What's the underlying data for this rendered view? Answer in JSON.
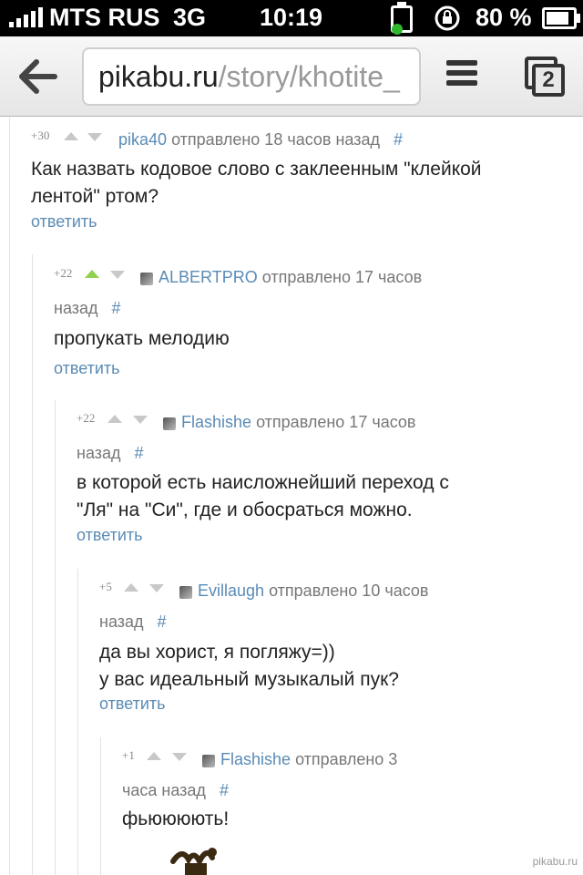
{
  "status": {
    "carrier": "MTS RUS",
    "network": "3G",
    "time": "10:19",
    "battery": "80 %"
  },
  "browser": {
    "url_host": "pikabu.ru",
    "url_path": "/story/khotite_"
  },
  "tabs_count": "2",
  "comments": [
    {
      "score": "+30",
      "nick": "pika40",
      "meta_line1": "отправлено 18 часов назад",
      "meta_line2": "",
      "text_lines": [
        "Как назвать кодовое слово с заклеенным \"клейкой",
        "лентой\" ртом?"
      ],
      "reply": "ответить",
      "upvoted": false,
      "has_avatar": false
    },
    {
      "score": "+22",
      "nick": "ALBERTPRO",
      "meta_line1": "отправлено 17 часов",
      "meta_line2": "назад",
      "text_lines": [
        "пропукать мелодию"
      ],
      "reply": "ответить",
      "upvoted": true,
      "has_avatar": true
    },
    {
      "score": "+22",
      "nick": "Flashishe",
      "meta_line1": "отправлено 17 часов",
      "meta_line2": "назад",
      "text_lines": [
        "в которой есть наисложнейший переход с",
        "\"Ля\" на \"Си\", где и обосраться можно."
      ],
      "reply": "ответить",
      "upvoted": false,
      "has_avatar": true
    },
    {
      "score": "+5",
      "nick": "Evillaugh",
      "meta_line1": "отправлено 10 часов",
      "meta_line2": "назад",
      "text_lines": [
        "да вы хорист, я погляжу=))",
        "у вас идеальный музыкалый пук?"
      ],
      "reply": "ответить",
      "upvoted": false,
      "has_avatar": true
    },
    {
      "score": "+1",
      "nick": "Flashishe",
      "meta_line1": "отправлено 3",
      "meta_line2": "часа назад",
      "text_lines": [
        "фьюююють!"
      ],
      "reply": "",
      "upvoted": false,
      "has_avatar": true
    }
  ],
  "hash": "#",
  "watermark": "pikabu.ru"
}
